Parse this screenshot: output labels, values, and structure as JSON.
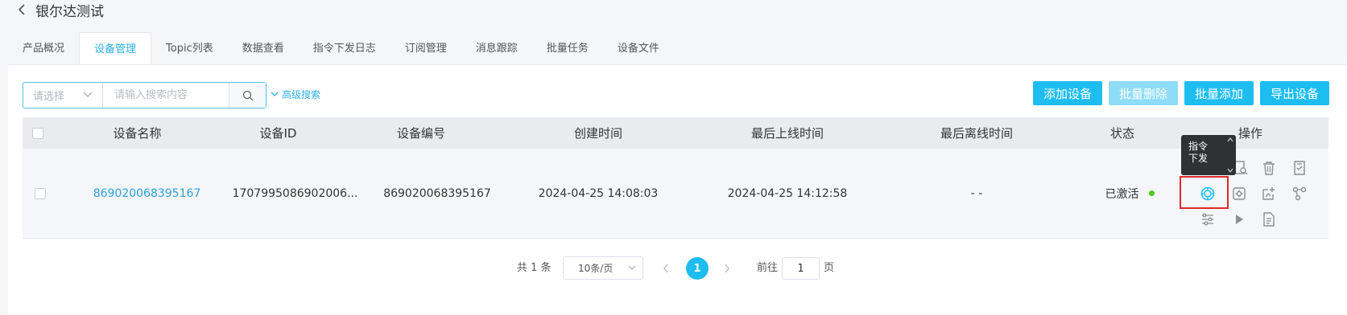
{
  "header": {
    "title": "银尔达测试",
    "back_icon": "chevron-left-icon"
  },
  "tabs": [
    {
      "label": "产品概况",
      "active": false
    },
    {
      "label": "设备管理",
      "active": true
    },
    {
      "label": "Topic列表",
      "active": false
    },
    {
      "label": "数据查看",
      "active": false
    },
    {
      "label": "指令下发日志",
      "active": false
    },
    {
      "label": "订阅管理",
      "active": false
    },
    {
      "label": "消息跟踪",
      "active": false
    },
    {
      "label": "批量任务",
      "active": false
    },
    {
      "label": "设备文件",
      "active": false
    }
  ],
  "search": {
    "select_placeholder": "请选择",
    "input_placeholder": "请输入搜索内容",
    "advanced_label": "高级搜索"
  },
  "toolbar": {
    "add_device": "添加设备",
    "batch_delete": "批量删除",
    "batch_add": "批量添加",
    "export_devices": "导出设备"
  },
  "table": {
    "columns": [
      "设备名称",
      "设备ID",
      "设备编号",
      "创建时间",
      "最后上线时间",
      "最后离线时间",
      "状态",
      "操作"
    ],
    "rows": [
      {
        "name": "869020068395167",
        "id": "1707995086902006...",
        "number": "869020068395167",
        "created": "2024-04-25 14:08:03",
        "last_online": "2024-04-25 14:12:58",
        "last_offline": "- -",
        "status": "已激活"
      }
    ]
  },
  "tooltip": {
    "line1": "指令",
    "line2": "下发"
  },
  "pagination": {
    "total": "共 1 条",
    "page_size": "10条/页",
    "current_page": "1",
    "goto_label": "前往",
    "goto_value": "1",
    "page_suffix": "页"
  },
  "colors": {
    "accent": "#1ebdf0",
    "link": "#2f9fd8",
    "status_active": "#52c41a",
    "highlight": "#e02a2a"
  }
}
